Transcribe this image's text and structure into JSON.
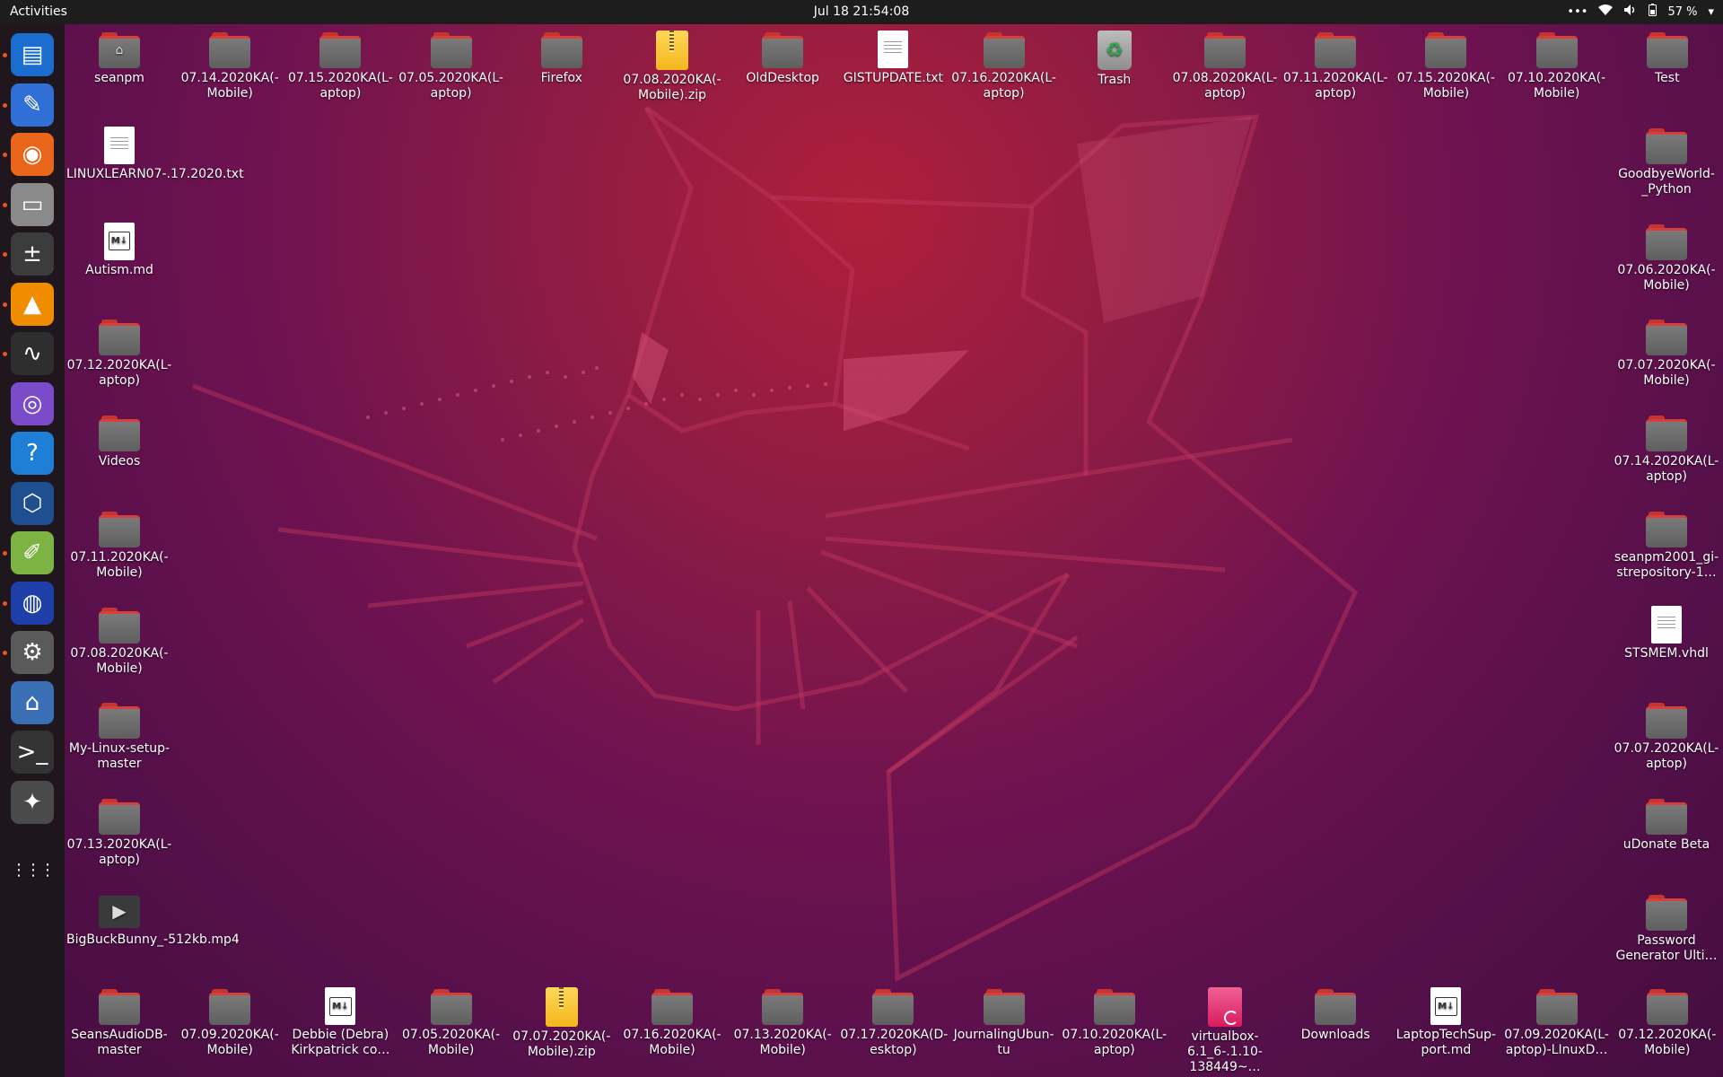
{
  "topbar": {
    "activities": "Activities",
    "clock": "Jul 18  21:54:08",
    "menu_dots": "•••",
    "battery": "57 %"
  },
  "dock": {
    "items": [
      {
        "name": "libreoffice-impress-icon",
        "glyph": "▤",
        "color": "#1c6dd0",
        "running": true
      },
      {
        "name": "text-editor-icon",
        "glyph": "✎",
        "color": "#2f6fd6",
        "running": true
      },
      {
        "name": "firefox-icon",
        "glyph": "◉",
        "color": "#e8651a",
        "running": true
      },
      {
        "name": "files-icon",
        "glyph": "▭",
        "color": "#8a8a8a",
        "running": true
      },
      {
        "name": "calculator-icon",
        "glyph": "±",
        "color": "#3c3c3c",
        "running": true
      },
      {
        "name": "vlc-icon",
        "glyph": "▲",
        "color": "#f08c00",
        "running": true
      },
      {
        "name": "system-monitor-icon",
        "glyph": "∿",
        "color": "#2e2e2e",
        "running": true
      },
      {
        "name": "screenshot-icon",
        "glyph": "◎",
        "color": "#7b4cc9",
        "running": false
      },
      {
        "name": "help-icon",
        "glyph": "?",
        "color": "#1f7ed6",
        "running": false
      },
      {
        "name": "virtualbox-icon",
        "glyph": "⬡",
        "color": "#1d4f91",
        "running": false
      },
      {
        "name": "sticky-notes-icon",
        "glyph": "✐",
        "color": "#7cb342",
        "running": true
      },
      {
        "name": "audacity-icon",
        "glyph": "◍",
        "color": "#1e3fa8",
        "running": true
      },
      {
        "name": "rhythmbox-icon",
        "glyph": "⚙",
        "color": "#5a5a5a",
        "running": true
      },
      {
        "name": "disk-icon",
        "glyph": "⌂",
        "color": "#3a6fb5",
        "running": false
      },
      {
        "name": "terminal-icon",
        "glyph": ">_",
        "color": "#333333",
        "running": false
      },
      {
        "name": "gimp-icon",
        "glyph": "✦",
        "color": "#4a4a4a",
        "running": false
      },
      {
        "name": "show-applications-icon",
        "glyph": "⋮⋮⋮",
        "color": "transparent",
        "running": false
      }
    ]
  },
  "desktop": {
    "top_row": [
      {
        "label": "seanpm",
        "type": "home"
      },
      {
        "label": "07.14.2020KA(-Mobile)",
        "type": "folder"
      },
      {
        "label": "07.15.2020KA(L-aptop)",
        "type": "folder"
      },
      {
        "label": "07.05.2020KA(L-aptop)",
        "type": "folder"
      },
      {
        "label": "Firefox",
        "type": "folder"
      },
      {
        "label": "07.08.2020KA(-Mobile).zip",
        "type": "zip"
      },
      {
        "label": "OldDesktop",
        "type": "folder"
      },
      {
        "label": "GISTUPDATE.txt",
        "type": "text"
      },
      {
        "label": "07.16.2020KA(L-aptop)",
        "type": "folder"
      },
      {
        "label": "Trash",
        "type": "trash"
      },
      {
        "label": "07.08.2020KA(L-aptop)",
        "type": "folder"
      },
      {
        "label": "07.11.2020KA(L-aptop)",
        "type": "folder"
      },
      {
        "label": "07.15.2020KA(-Mobile)",
        "type": "folder"
      },
      {
        "label": "07.10.2020KA(-Mobile)",
        "type": "folder"
      },
      {
        "label": "Test",
        "type": "folder"
      }
    ],
    "left_column": [
      {
        "label": "LINUXLEARN07-.17.2020.txt",
        "type": "text"
      },
      {
        "label": "Autism.md",
        "type": "md"
      },
      {
        "label": "07.12.2020KA(L-aptop)",
        "type": "folder"
      },
      {
        "label": "Videos",
        "type": "folder"
      },
      {
        "label": "07.11.2020KA(-Mobile)",
        "type": "folder"
      },
      {
        "label": "07.08.2020KA(-Mobile)",
        "type": "folder"
      },
      {
        "label": "My-Linux-setup-master",
        "type": "folder"
      },
      {
        "label": "07.13.2020KA(L-aptop)",
        "type": "folder"
      },
      {
        "label": "BigBuckBunny_-512kb.mp4",
        "type": "video"
      }
    ],
    "right_column": [
      {
        "label": "GoodbyeWorld-_Python",
        "type": "folder"
      },
      {
        "label": "07.06.2020KA(-Mobile)",
        "type": "folder"
      },
      {
        "label": "07.07.2020KA(-Mobile)",
        "type": "folder"
      },
      {
        "label": "07.14.2020KA(L-aptop)",
        "type": "folder"
      },
      {
        "label": "seanpm2001_gi-strepository-1…",
        "type": "folder"
      },
      {
        "label": "STSMEM.vhdl",
        "type": "text"
      },
      {
        "label": "07.07.2020KA(L-aptop)",
        "type": "folder"
      },
      {
        "label": "uDonate Beta",
        "type": "folder"
      },
      {
        "label": "Password Generator Ulti…",
        "type": "folder"
      }
    ],
    "bottom_row": [
      {
        "label": "SeansAudioDB-master",
        "type": "folder"
      },
      {
        "label": "07.09.2020KA(-Mobile)",
        "type": "folder"
      },
      {
        "label": "Debbie (Debra) Kirkpatrick co…",
        "type": "md"
      },
      {
        "label": "07.05.2020KA(-Mobile)",
        "type": "folder"
      },
      {
        "label": "07.07.2020KA(-Mobile).zip",
        "type": "zip"
      },
      {
        "label": "07.16.2020KA(-Mobile)",
        "type": "folder"
      },
      {
        "label": "07.13.2020KA(-Mobile)",
        "type": "folder"
      },
      {
        "label": "07.17.2020KA(D-esktop)",
        "type": "folder"
      },
      {
        "label": "JournalingUbun-tu",
        "type": "folder"
      },
      {
        "label": "07.10.2020KA(L-aptop)",
        "type": "folder"
      },
      {
        "label": "virtualbox-6.1_6-.1.10-138449~…",
        "type": "deb"
      },
      {
        "label": "Downloads",
        "type": "folder"
      },
      {
        "label": "LaptopTechSup-port.md",
        "type": "md"
      },
      {
        "label": "07.09.2020KA(L-aptop)-LInuxD…",
        "type": "folder"
      },
      {
        "label": "07.12.2020KA(-Mobile)",
        "type": "folder"
      }
    ]
  }
}
